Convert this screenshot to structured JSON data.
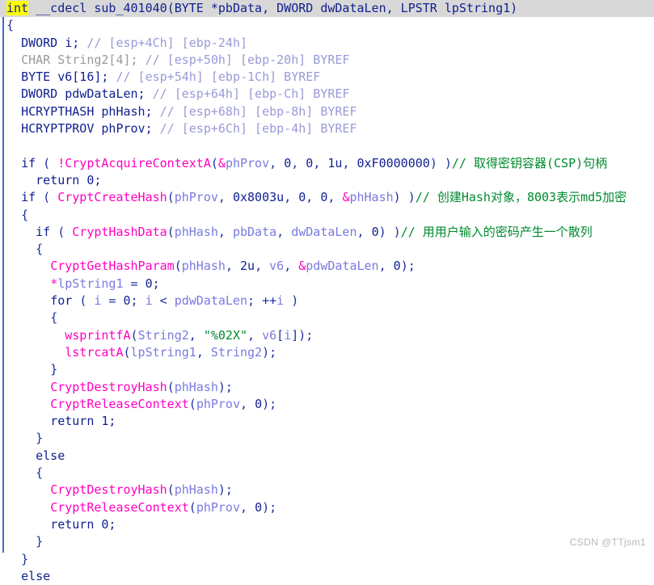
{
  "window": {
    "kind": "decompiler-pseudocode-view",
    "watermark": "CSDN @TTjsm1"
  },
  "colors": {
    "keyword": "#0f1f8f",
    "function": "#ff00c0",
    "variable": "#7a7ae0",
    "comment": "#008a2e",
    "declaration_comment": "#9a9ad8",
    "grayed_identifier": "#9a9a9a",
    "cursor_highlight": "#ffff00",
    "current_line_background": "#d8d8d8",
    "scope_bar": "#4169d0",
    "background": "#ffffff"
  },
  "code": {
    "signature": {
      "return_type": "int",
      "calling_convention": "__cdecl",
      "name": "sub_401040",
      "params": "(BYTE *pbData, DWORD dwDataLen, LPSTR lpString1)",
      "full_line": "int __cdecl sub_401040(BYTE *pbData, DWORD dwDataLen, LPSTR lpString1)"
    },
    "declarations": [
      {
        "type": "DWORD",
        "name": "i;",
        "comment": "// [esp+4Ch] [ebp-24h]"
      },
      {
        "type": "CHAR",
        "name": "String2[4];",
        "comment": "// [esp+50h] [ebp-20h] BYREF"
      },
      {
        "type": "BYTE",
        "name": "v6[16];",
        "comment": "// [esp+54h] [ebp-1Ch] BYREF"
      },
      {
        "type": "DWORD",
        "name": "pdwDataLen;",
        "comment": "// [esp+64h] [ebp-Ch] BYREF"
      },
      {
        "type": "HCRYPTHASH",
        "name": "phHash;",
        "comment": "// [esp+68h] [ebp-8h] BYREF"
      },
      {
        "type": "HCRYPTPROV",
        "name": "phProv;",
        "comment": "// [esp+6Ch] [ebp-4h] BYREF"
      }
    ],
    "statements": {
      "acquire_context_call": "CryptAcquireContextA(&phProv, 0, 0, 1u, 0xF0000000)",
      "acquire_context_comment": "// 取得密钥容器(CSP)句柄",
      "create_hash_call": "CryptCreateHash(phProv, 0x8003u, 0, 0, &phHash)",
      "create_hash_comment": "// 创建Hash对象，8003表示md5加密",
      "hash_data_call": "CryptHashData(phHash, pbData, dwDataLen, 0)",
      "hash_data_comment": "// 用用户输入的密码产生一个散列",
      "get_hash_param": "CryptGetHashParam(phHash, 2u, v6, &pdwDataLen, 0);",
      "reset_string": "*lpString1 = 0;",
      "for_header": "for ( i = 0; i < pdwDataLen; ++i )",
      "wsprintf": "wsprintfA(String2, \"%02X\", v6[i]);",
      "format_string": "\"%02X\"",
      "lstrcat": "lstrcatA(lpString1, String2);",
      "destroy_hash": "CryptDestroyHash(phHash);",
      "release_context": "CryptReleaseContext(phProv, 0);",
      "return_one": "return 1;",
      "return_zero": "return 0;",
      "keyword_if": "if",
      "keyword_else": "else",
      "keyword_return": "return",
      "keyword_for": "for",
      "brace_open": "{",
      "brace_close": "}"
    }
  }
}
